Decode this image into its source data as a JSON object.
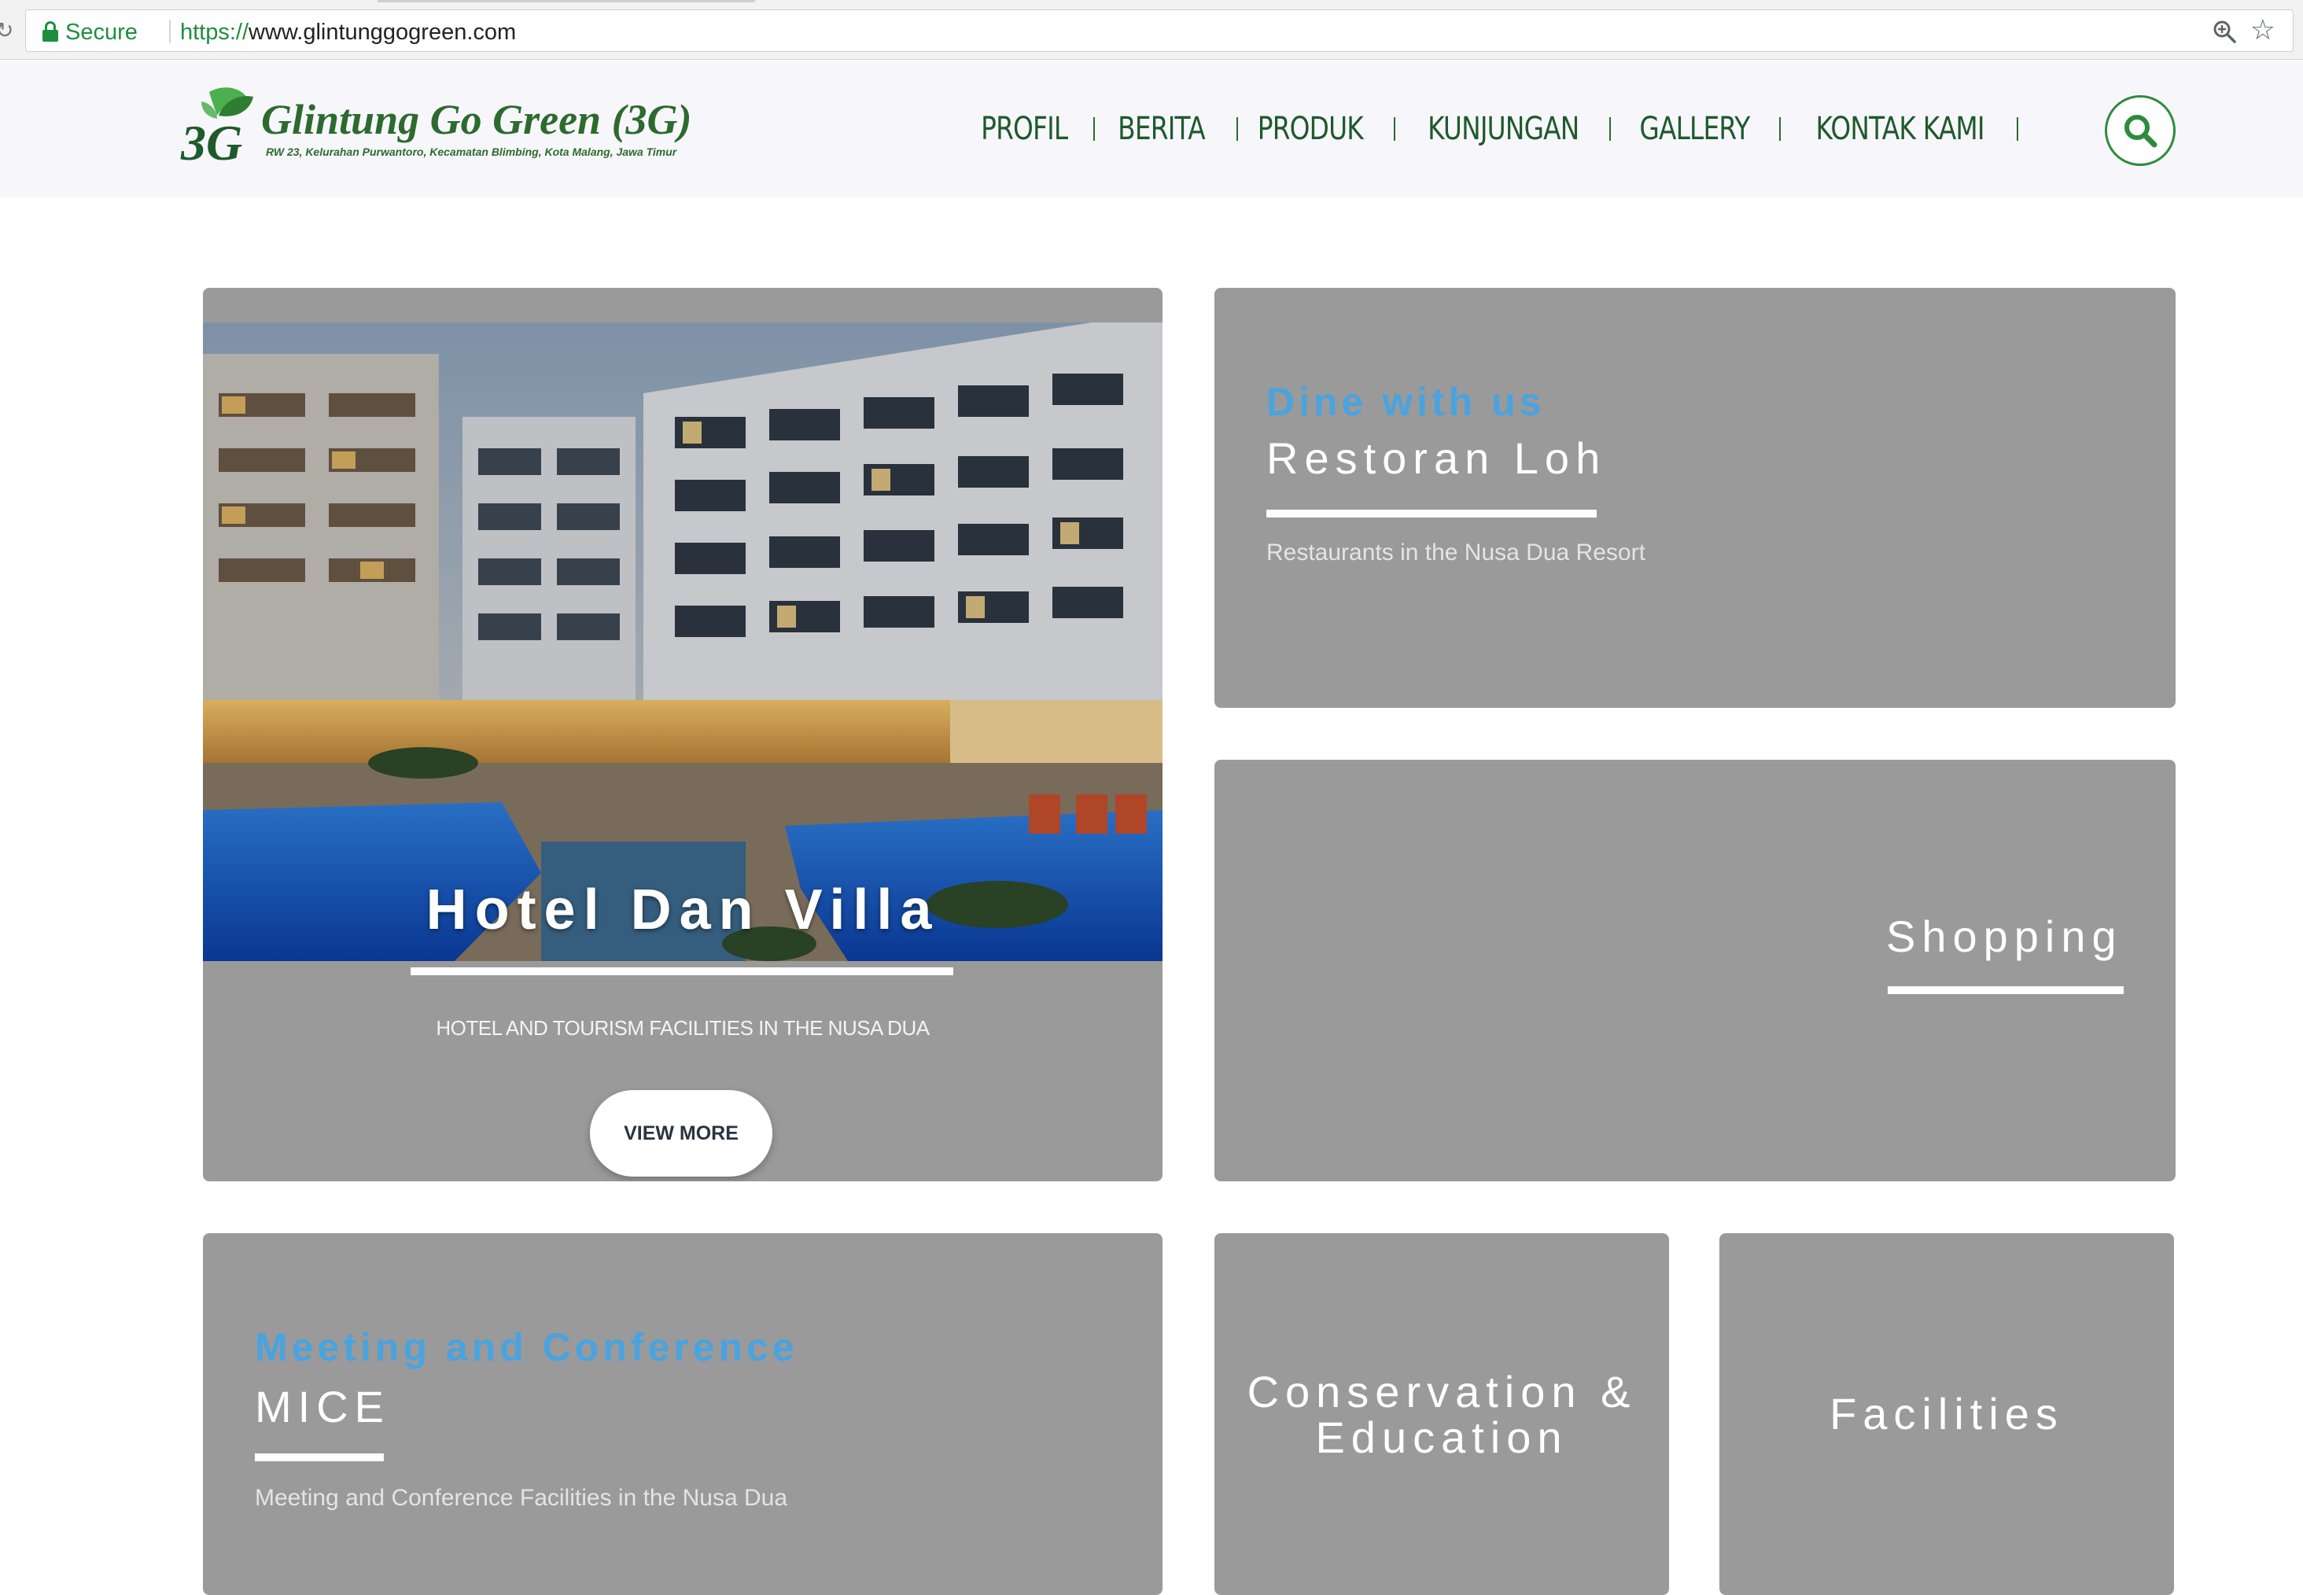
{
  "browser": {
    "secure_label": "Secure",
    "url_scheme": "https://",
    "url_host": "www.glintunggogreen.com",
    "icons": [
      "lock-icon",
      "zoom-icon",
      "star-icon"
    ]
  },
  "header": {
    "logo_title": "Glintung Go Green (3G)",
    "logo_subtitle": "RW 23, Kelurahan Purwantoro, Kecamatan Blimbing, Kota Malang, Jawa Timur",
    "logo_mark_text": "3G",
    "nav": [
      {
        "label": "PROFIL"
      },
      {
        "label": "BERITA"
      },
      {
        "label": "PRODUK"
      },
      {
        "label": "KUNJUNGAN"
      },
      {
        "label": "GALLERY"
      },
      {
        "label": "KONTAK KAMI"
      }
    ],
    "search_icon": "search-icon",
    "brand_color": "#2d6a2e"
  },
  "tiles": {
    "hotel": {
      "title": "Hotel Dan Villa",
      "subtitle": "HOTEL AND TOURISM FACILITIES IN THE NUSA DUA",
      "button": "VIEW MORE",
      "stray_mark": "\""
    },
    "restoran": {
      "kicker": "Dine with us",
      "title": "Restoran Loh",
      "description": "Restaurants in the Nusa Dua Resort"
    },
    "shopping": {
      "title": "Shopping"
    },
    "mice": {
      "kicker": "Meeting and Conference",
      "title": "MICE",
      "description": "Meeting and Conference Facilities in the Nusa Dua"
    },
    "conservation": {
      "line1": "Conservation &",
      "line2": "Education"
    },
    "facilities": {
      "title": "Facilities"
    },
    "tile_color": "#9a9a9a",
    "kicker_color": "#4aa3df"
  }
}
